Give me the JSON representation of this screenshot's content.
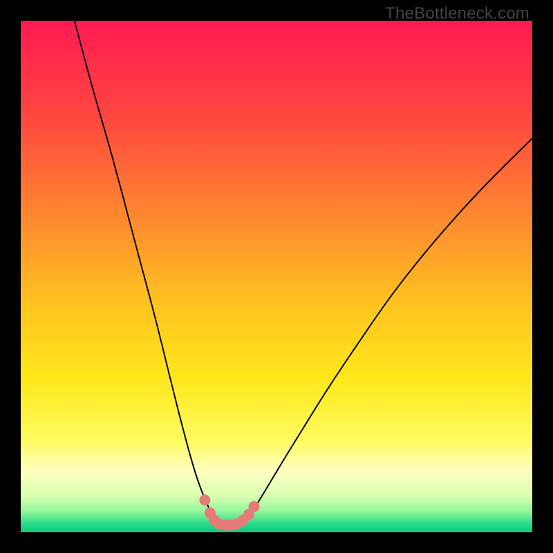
{
  "watermark": "TheBottleneck.com",
  "chart_data": {
    "type": "line",
    "title": "",
    "xlabel": "",
    "ylabel": "",
    "xlim": [
      0,
      100
    ],
    "ylim": [
      0,
      100
    ],
    "background_gradient": {
      "stops": [
        {
          "offset": 0.0,
          "color": "#ff1a52"
        },
        {
          "offset": 0.2,
          "color": "#ff4a3e"
        },
        {
          "offset": 0.4,
          "color": "#ff8e2e"
        },
        {
          "offset": 0.55,
          "color": "#ffc21f"
        },
        {
          "offset": 0.7,
          "color": "#ffe81a"
        },
        {
          "offset": 0.82,
          "color": "#fffc60"
        },
        {
          "offset": 0.88,
          "color": "#ffffc0"
        },
        {
          "offset": 0.93,
          "color": "#d7ffb0"
        },
        {
          "offset": 0.96,
          "color": "#90f59a"
        },
        {
          "offset": 0.985,
          "color": "#22d98a"
        },
        {
          "offset": 1.0,
          "color": "#0fc97e"
        }
      ]
    },
    "series": [
      {
        "name": "bottleneck-curve",
        "type": "line",
        "color": "#000000",
        "width": 2.0,
        "x": [
          10.5,
          14,
          18,
          22,
          26,
          29,
          31,
          33,
          34.5,
          36,
          37.2,
          38.5,
          43.5,
          45.5,
          48,
          51,
          55,
          60,
          66,
          73,
          81,
          90,
          100
        ],
        "y": [
          100,
          87,
          73,
          58,
          43,
          31,
          23,
          15.5,
          10.5,
          6.5,
          4.0,
          2.2,
          2.2,
          4.5,
          8.5,
          13.5,
          20,
          28,
          37,
          47,
          57,
          67,
          77
        ]
      },
      {
        "name": "highlight-dots",
        "type": "scatter",
        "color": "#e77a77",
        "radius": 8,
        "x": [
          36.0,
          37.0,
          37.8,
          38.8,
          40.0,
          41.2,
          42.4,
          43.5,
          44.6,
          45.6
        ],
        "y": [
          6.3,
          3.8,
          2.4,
          1.6,
          1.4,
          1.4,
          1.7,
          2.4,
          3.5,
          5.0
        ]
      }
    ]
  }
}
